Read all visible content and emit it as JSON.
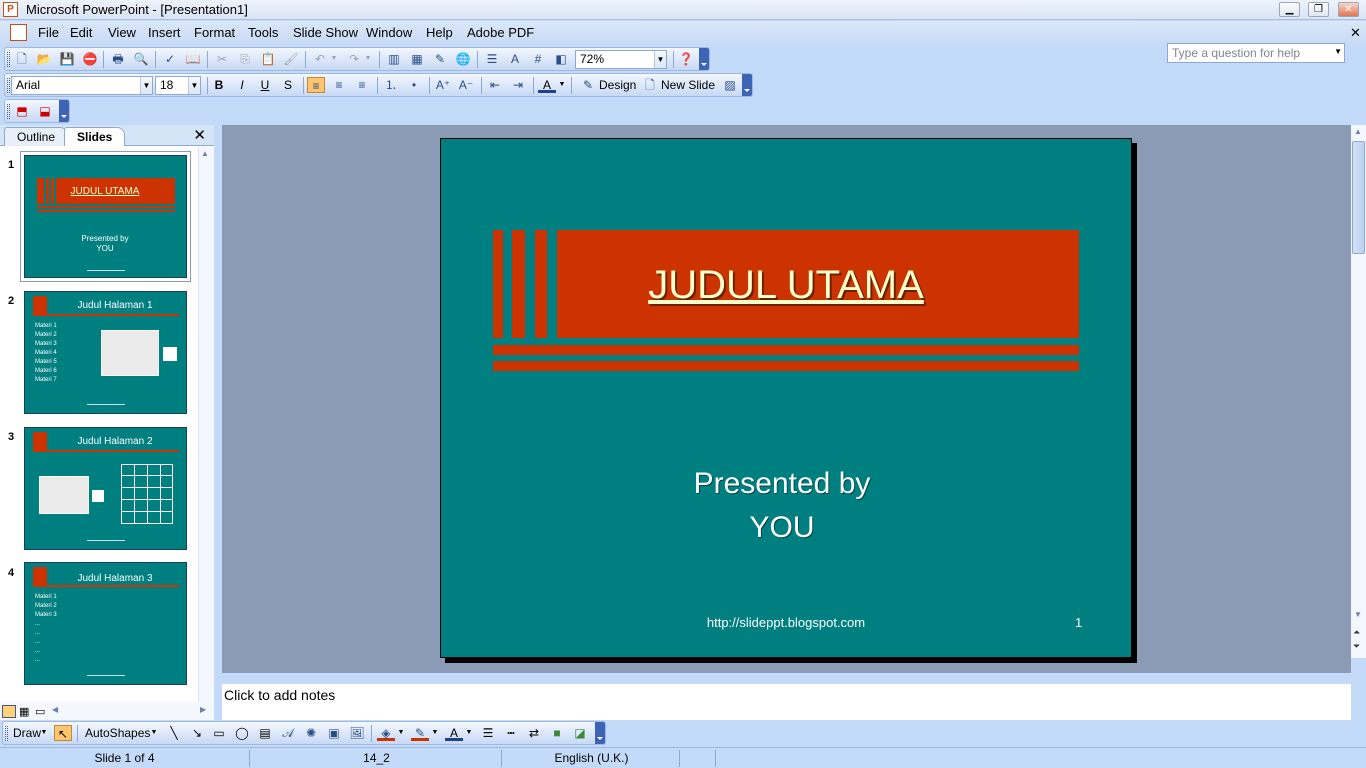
{
  "window": {
    "title": "Microsoft PowerPoint - [Presentation1]",
    "app_icon": "P"
  },
  "menu": [
    "File",
    "Edit",
    "View",
    "Insert",
    "Format",
    "Tools",
    "Slide Show",
    "Window",
    "Help",
    "Adobe PDF"
  ],
  "help_box": {
    "placeholder": "Type a question for help"
  },
  "toolbar_standard": {
    "zoom": "72%"
  },
  "toolbar_formatting": {
    "font": "Arial",
    "size": "18",
    "design_label": "Design",
    "new_slide_label": "New Slide"
  },
  "panel": {
    "tabs": [
      "Outline",
      "Slides"
    ],
    "active_tab": "Slides",
    "close": "✕"
  },
  "thumbnails": [
    {
      "num": "1",
      "title": "JUDUL UTAMA",
      "sub1": "Presented by",
      "sub2": "YOU"
    },
    {
      "num": "2",
      "title": "Judul Halaman 1",
      "bullets": [
        "Materi 1",
        "Materi 2",
        "Materi 3",
        "Materi 4",
        "Materi 5",
        "Materi 6",
        "Materi 7"
      ]
    },
    {
      "num": "3",
      "title": "Judul Halaman 2"
    },
    {
      "num": "4",
      "title": "Judul Halaman 3",
      "bullets": [
        "Materi 1",
        "Materi 2",
        "Materi 3",
        "...",
        "...",
        "...",
        "...",
        "..."
      ]
    }
  ],
  "slide": {
    "title": "JUDUL UTAMA",
    "subtitle_line1": "Presented by",
    "subtitle_line2": "YOU",
    "footer": "http://slideppt.blogspot.com",
    "page_number": "1"
  },
  "notes": {
    "placeholder": "Click to add notes"
  },
  "drawing": {
    "draw_label": "Draw",
    "autoshapes_label": "AutoShapes"
  },
  "status": {
    "slide": "Slide 1 of 4",
    "design": "14_2",
    "language": "English (U.K.)"
  },
  "colors": {
    "slide_bg": "#007f80",
    "accent": "#cc3300",
    "title_text": "#ffffcc",
    "ui_bg": "#c3daf9"
  }
}
